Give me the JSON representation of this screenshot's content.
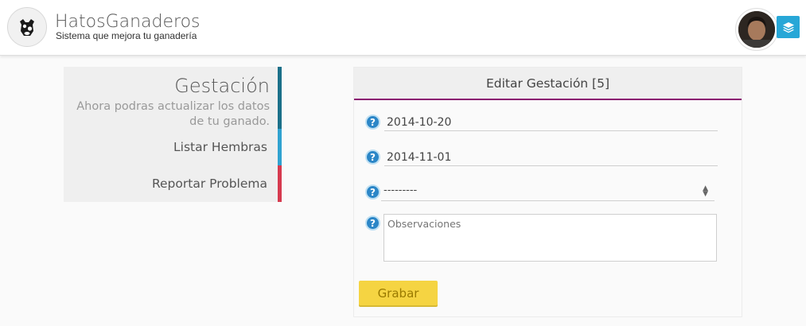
{
  "header": {
    "app_title": "HatosGanaderos",
    "app_subtitle": "Sistema que mejora tu ganadería",
    "logo_icon": "cow-icon",
    "layers_icon": "layers-icon",
    "accent_color": "#27a7d7"
  },
  "sidebar": {
    "title": "Gestación",
    "description": "Ahora podras actualizar los datos de tu ganado.",
    "items": [
      {
        "label": "Listar Hembras",
        "color": "#30a2d0"
      },
      {
        "label": "Reportar Problema",
        "color": "#d63a4f"
      }
    ],
    "title_color": "#1b7089"
  },
  "form": {
    "title": "Editar Gestación [5]",
    "header_border_color": "#8a1070",
    "fields": {
      "date1": "2014-10-20",
      "date2": "2014-11-01",
      "select_value": "---------",
      "observations_placeholder": "Observaciones"
    },
    "help_icon": "question-icon",
    "submit_label": "Grabar",
    "submit_color": "#f5d442"
  }
}
